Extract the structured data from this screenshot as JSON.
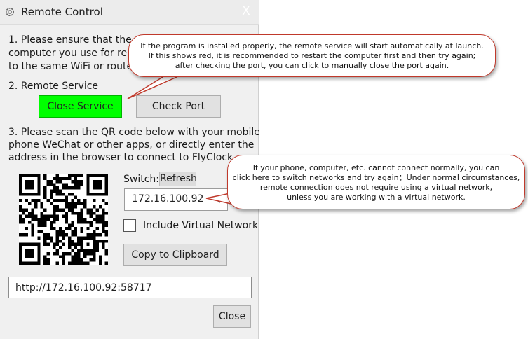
{
  "window": {
    "title": "Remote Control",
    "close_glyph": "X",
    "icon": "gear-icon"
  },
  "step1": {
    "line1": "1. Please ensure that the mobi",
    "line2": "computer you use for remo",
    "line3": "to the same WiFi or router a"
  },
  "step2": {
    "label": "2. Remote Service",
    "close_service_label": "Close Service",
    "check_port_label": "Check Port"
  },
  "step3": {
    "line1": "3. Please scan the QR code below with your mobile",
    "line2": "phone WeChat or other apps, or directly enter the",
    "line3": "address in the browser to connect to FlyClock."
  },
  "network": {
    "switch_label": "Switch:",
    "refresh_label": "Refresh",
    "selected_ip": "172.16.100.92",
    "virtual_network_label": "Include Virtual Network",
    "copy_label": "Copy to Clipboard"
  },
  "url": {
    "value": "http://172.16.100.92:58717"
  },
  "footer": {
    "close_label": "Close"
  },
  "tooltips": {
    "service": [
      "If the program is installed properly, the remote service will start automatically at launch.",
      "If this shows red, it is recommended to restart the computer first and then try again;",
      "after checking the port, you can click to manually close the port again."
    ],
    "network": [
      "If your phone, computer, etc. cannot connect normally, you can",
      "click here to switch networks and try again；Under normal circumstances,",
      "remote connection does not require using a virtual network,",
      "unless you are working with a virtual network."
    ]
  },
  "colors": {
    "service_active": "#00ff00",
    "callout_border": "#c0392b"
  }
}
